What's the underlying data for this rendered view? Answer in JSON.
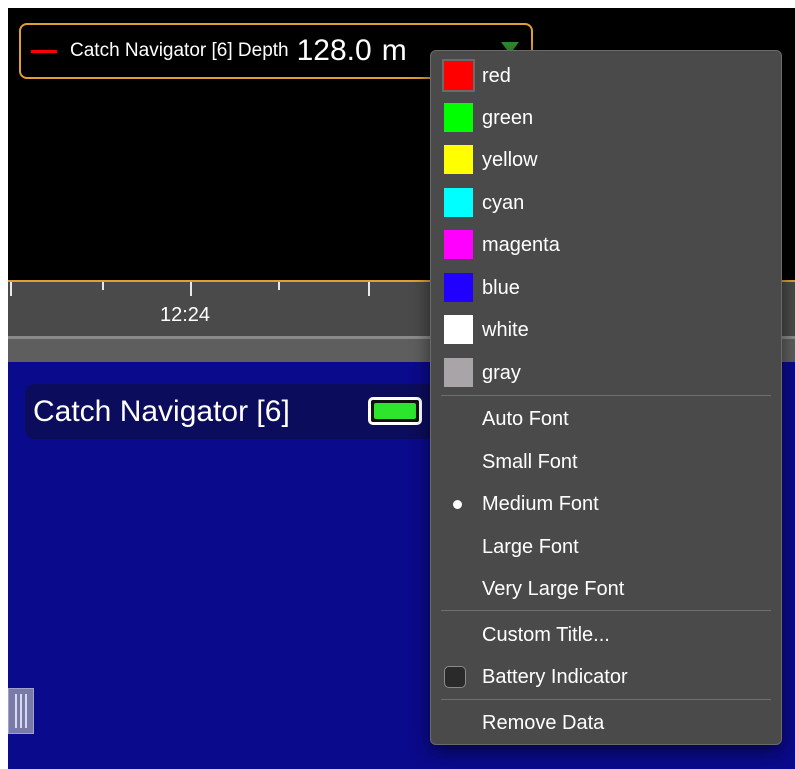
{
  "legend": {
    "label": "Catch Navigator [6] Depth",
    "value": "128.0",
    "unit": "m",
    "line_color": "#ff0000"
  },
  "time_axis": {
    "label": "12:24"
  },
  "device_card": {
    "name": "Catch Navigator [6]",
    "battery_color": "#2ee52e"
  },
  "menu": {
    "colors": [
      {
        "label": "red",
        "hex": "#ff0000"
      },
      {
        "label": "green",
        "hex": "#00ff00"
      },
      {
        "label": "yellow",
        "hex": "#ffff00"
      },
      {
        "label": "cyan",
        "hex": "#00ffff"
      },
      {
        "label": "magenta",
        "hex": "#ff00ff"
      },
      {
        "label": "blue",
        "hex": "#2200ff"
      },
      {
        "label": "white",
        "hex": "#ffffff"
      },
      {
        "label": "gray",
        "hex": "#a8a4a8"
      }
    ],
    "fonts": [
      {
        "label": "Auto Font",
        "selected": false
      },
      {
        "label": "Small Font",
        "selected": false
      },
      {
        "label": "Medium Font",
        "selected": true
      },
      {
        "label": "Large Font",
        "selected": false
      },
      {
        "label": "Very Large Font",
        "selected": false
      }
    ],
    "custom_title": "Custom Title...",
    "battery_indicator": "Battery Indicator",
    "battery_indicator_checked": false,
    "remove_data": "Remove Data"
  }
}
